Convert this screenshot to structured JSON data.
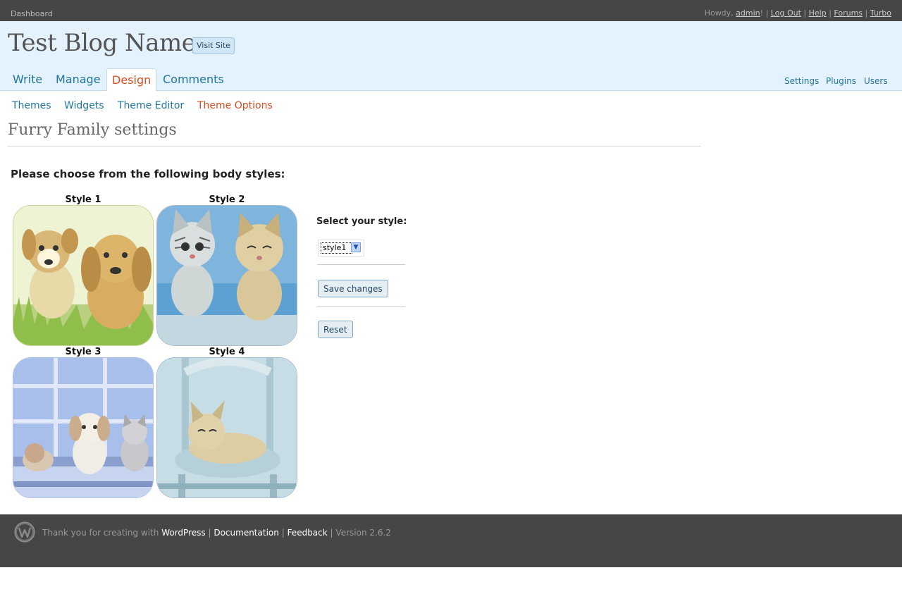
{
  "topbar": {
    "dashboard": "Dashboard",
    "howdy": "Howdy,",
    "user": "admin",
    "excl": "!",
    "log_out": "Log Out",
    "help": "Help",
    "forums": "Forums",
    "turbo": "Turbo",
    "sep": "|"
  },
  "header": {
    "blog_name": "Test Blog Name",
    "visit_site": "Visit Site",
    "nav": [
      "Write",
      "Manage",
      "Design",
      "Comments"
    ],
    "right_nav": [
      "Settings",
      "Plugins",
      "Users"
    ]
  },
  "subnav": [
    "Themes",
    "Widgets",
    "Theme Editor",
    "Theme Options"
  ],
  "page": {
    "title": "Furry Family settings",
    "prompt": "Please choose from the following body styles:",
    "styles": [
      "Style 1",
      "Style 2",
      "Style 3",
      "Style 4"
    ],
    "select_label": "Select your style:",
    "selected": "style1",
    "save": "Save changes",
    "reset": "Reset"
  },
  "footer": {
    "thanks": "Thank you for creating with",
    "wordpress": "WordPress",
    "documentation": "Documentation",
    "feedback": "Feedback",
    "version": "Version 2.6.2",
    "sep": "|"
  },
  "colors": {
    "link": "#21759b",
    "active": "#d54e21",
    "header_bg": "#e4f2fd",
    "dark_bar": "#464646"
  }
}
